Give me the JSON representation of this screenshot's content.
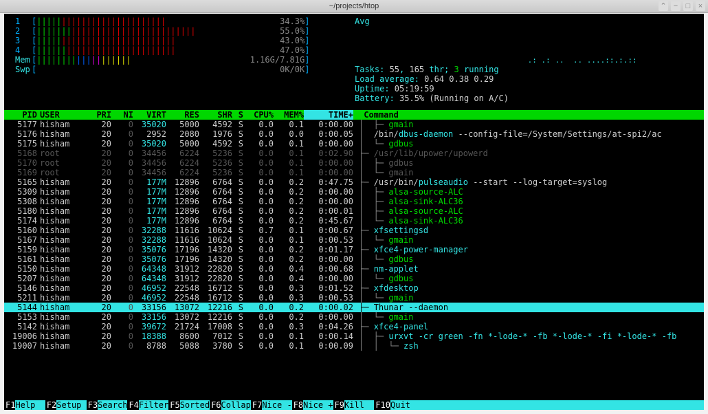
{
  "window": {
    "title": "~/projects/htop"
  },
  "cpu": [
    {
      "n": "1",
      "pct": "34.3%"
    },
    {
      "n": "2",
      "pct": "55.0%"
    },
    {
      "n": "3",
      "pct": "43.0%"
    },
    {
      "n": "4",
      "pct": "47.0%"
    }
  ],
  "mem": {
    "label": "Mem",
    "val": "1.16G/7.81G"
  },
  "swp": {
    "label": "Swp",
    "val": "0K/0K"
  },
  "avg_label": "Avg",
  "tasks": {
    "total": "55",
    "thr": "165",
    "running": "3"
  },
  "load": {
    "label": "Load average:",
    "v1": "0.64",
    "v2": "0.38",
    "v3": "0.29"
  },
  "uptime": {
    "label": "Uptime:",
    "v": "05:19:59"
  },
  "battery": {
    "label": "Battery:",
    "v": "35.5% (Running on A/C)"
  },
  "columns": [
    "  PID",
    "USER    ",
    "  PRI",
    "  NI",
    " VIRT",
    "  RES",
    "  SHR",
    " S",
    " CPU%",
    " MEM%",
    "   TIME+",
    " Command"
  ],
  "procs": [
    {
      "pid": "5177",
      "user": "hisham",
      "pri": "20",
      "ni": "0",
      "virt": "35020",
      "res": "5000",
      "shr": "4592",
      "s": "S",
      "cpu": "0.0",
      "mem": "0.1",
      "time": "0:00.00",
      "tree": "│  ├─ ",
      "cmd": "gmain",
      "style": "thr",
      "mvirt": true
    },
    {
      "pid": "5176",
      "user": "hisham",
      "pri": "20",
      "ni": "0",
      "virt": "2952",
      "res": "2080",
      "shr": "1976",
      "s": "S",
      "cpu": "0.0",
      "mem": "0.0",
      "time": "0:00.05",
      "tree": "│  ",
      "cmd": "/bin/dbus-daemon --config-file=/System/Settings/at-spi2/ac",
      "style": "path"
    },
    {
      "pid": "5175",
      "user": "hisham",
      "pri": "20",
      "ni": "0",
      "virt": "35020",
      "res": "5000",
      "shr": "4592",
      "s": "S",
      "cpu": "0.0",
      "mem": "0.1",
      "time": "0:00.00",
      "tree": "│  └─ ",
      "cmd": "gdbus",
      "style": "thr",
      "mvirt": true
    },
    {
      "pid": "5168",
      "user": "root",
      "pri": "20",
      "ni": "0",
      "virt": "34456",
      "res": "6224",
      "shr": "5236",
      "s": "S",
      "cpu": "0.0",
      "mem": "0.1",
      "time": "0:02.90",
      "tree": "├─ ",
      "cmd": "/usr/lib/upower/upowerd",
      "style": "dim"
    },
    {
      "pid": "5170",
      "user": "root",
      "pri": "20",
      "ni": "0",
      "virt": "34456",
      "res": "6224",
      "shr": "5236",
      "s": "S",
      "cpu": "0.0",
      "mem": "0.1",
      "time": "0:00.00",
      "tree": "│  ├─ ",
      "cmd": "gdbus",
      "style": "dim"
    },
    {
      "pid": "5169",
      "user": "root",
      "pri": "20",
      "ni": "0",
      "virt": "34456",
      "res": "6224",
      "shr": "5236",
      "s": "S",
      "cpu": "0.0",
      "mem": "0.1",
      "time": "0:00.00",
      "tree": "│  └─ ",
      "cmd": "gmain",
      "style": "dim"
    },
    {
      "pid": "5165",
      "user": "hisham",
      "pri": "20",
      "ni": "0",
      "virt": "177M",
      "res": "12896",
      "shr": "6764",
      "s": "S",
      "cpu": "0.0",
      "mem": "0.2",
      "time": "0:47.75",
      "tree": "├─ ",
      "cmd": "/usr/bin/pulseaudio --start --log-target=syslog",
      "style": "path",
      "mvirt": true
    },
    {
      "pid": "5309",
      "user": "hisham",
      "pri": "20",
      "ni": "0",
      "virt": "177M",
      "res": "12896",
      "shr": "6764",
      "s": "S",
      "cpu": "0.0",
      "mem": "0.2",
      "time": "0:00.00",
      "tree": "│  ├─ ",
      "cmd": "alsa-source-ALC",
      "style": "thr",
      "mvirt": true
    },
    {
      "pid": "5308",
      "user": "hisham",
      "pri": "20",
      "ni": "0",
      "virt": "177M",
      "res": "12896",
      "shr": "6764",
      "s": "S",
      "cpu": "0.0",
      "mem": "0.2",
      "time": "0:00.00",
      "tree": "│  ├─ ",
      "cmd": "alsa-sink-ALC36",
      "style": "thr",
      "mvirt": true
    },
    {
      "pid": "5180",
      "user": "hisham",
      "pri": "20",
      "ni": "0",
      "virt": "177M",
      "res": "12896",
      "shr": "6764",
      "s": "S",
      "cpu": "0.0",
      "mem": "0.2",
      "time": "0:00.01",
      "tree": "│  ├─ ",
      "cmd": "alsa-source-ALC",
      "style": "thr",
      "mvirt": true
    },
    {
      "pid": "5174",
      "user": "hisham",
      "pri": "20",
      "ni": "0",
      "virt": "177M",
      "res": "12896",
      "shr": "6764",
      "s": "S",
      "cpu": "0.0",
      "mem": "0.2",
      "time": "0:45.67",
      "tree": "│  └─ ",
      "cmd": "alsa-sink-ALC36",
      "style": "thr",
      "mvirt": true
    },
    {
      "pid": "5160",
      "user": "hisham",
      "pri": "20",
      "ni": "0",
      "virt": "32288",
      "res": "11616",
      "shr": "10624",
      "s": "S",
      "cpu": "0.7",
      "mem": "0.1",
      "time": "0:00.67",
      "tree": "├─ ",
      "cmd": "xfsettingsd",
      "style": "exe",
      "mvirt": true
    },
    {
      "pid": "5167",
      "user": "hisham",
      "pri": "20",
      "ni": "0",
      "virt": "32288",
      "res": "11616",
      "shr": "10624",
      "s": "S",
      "cpu": "0.0",
      "mem": "0.1",
      "time": "0:00.53",
      "tree": "│  └─ ",
      "cmd": "gmain",
      "style": "thr",
      "mvirt": true
    },
    {
      "pid": "5159",
      "user": "hisham",
      "pri": "20",
      "ni": "0",
      "virt": "35076",
      "res": "17196",
      "shr": "14320",
      "s": "S",
      "cpu": "0.0",
      "mem": "0.2",
      "time": "0:01.17",
      "tree": "├─ ",
      "cmd": "xfce4-power-manager",
      "style": "exe",
      "mvirt": true
    },
    {
      "pid": "5161",
      "user": "hisham",
      "pri": "20",
      "ni": "0",
      "virt": "35076",
      "res": "17196",
      "shr": "14320",
      "s": "S",
      "cpu": "0.0",
      "mem": "0.2",
      "time": "0:00.00",
      "tree": "│  └─ ",
      "cmd": "gdbus",
      "style": "thr",
      "mvirt": true
    },
    {
      "pid": "5150",
      "user": "hisham",
      "pri": "20",
      "ni": "0",
      "virt": "64348",
      "res": "31912",
      "shr": "22820",
      "s": "S",
      "cpu": "0.0",
      "mem": "0.4",
      "time": "0:00.68",
      "tree": "├─ ",
      "cmd": "nm-applet",
      "style": "exe",
      "mvirt": true
    },
    {
      "pid": "5207",
      "user": "hisham",
      "pri": "20",
      "ni": "0",
      "virt": "64348",
      "res": "31912",
      "shr": "22820",
      "s": "S",
      "cpu": "0.0",
      "mem": "0.4",
      "time": "0:00.00",
      "tree": "│  └─ ",
      "cmd": "gdbus",
      "style": "thr",
      "mvirt": true
    },
    {
      "pid": "5146",
      "user": "hisham",
      "pri": "20",
      "ni": "0",
      "virt": "46952",
      "res": "22548",
      "shr": "16712",
      "s": "S",
      "cpu": "0.0",
      "mem": "0.3",
      "time": "0:01.52",
      "tree": "├─ ",
      "cmd": "xfdesktop",
      "style": "exe",
      "mvirt": true
    },
    {
      "pid": "5211",
      "user": "hisham",
      "pri": "20",
      "ni": "0",
      "virt": "46952",
      "res": "22548",
      "shr": "16712",
      "s": "S",
      "cpu": "0.0",
      "mem": "0.3",
      "time": "0:00.53",
      "tree": "│  └─ ",
      "cmd": "gmain",
      "style": "thr",
      "mvirt": true
    },
    {
      "pid": "5144",
      "user": "hisham",
      "pri": "20",
      "ni": "0",
      "virt": "33156",
      "res": "13072",
      "shr": "12216",
      "s": "S",
      "cpu": "0.0",
      "mem": "0.2",
      "time": "0:00.02",
      "tree": "├─ ",
      "cmd": "Thunar --daemon",
      "style": "sel",
      "mvirt": false,
      "selected": true
    },
    {
      "pid": "5153",
      "user": "hisham",
      "pri": "20",
      "ni": "0",
      "virt": "33156",
      "res": "13072",
      "shr": "12216",
      "s": "S",
      "cpu": "0.0",
      "mem": "0.2",
      "time": "0:00.00",
      "tree": "│  └─ ",
      "cmd": "gmain",
      "style": "thr",
      "mvirt": true
    },
    {
      "pid": "5142",
      "user": "hisham",
      "pri": "20",
      "ni": "0",
      "virt": "39672",
      "res": "21724",
      "shr": "17008",
      "s": "S",
      "cpu": "0.0",
      "mem": "0.3",
      "time": "0:04.26",
      "tree": "├─ ",
      "cmd": "xfce4-panel",
      "style": "exe",
      "mvirt": true
    },
    {
      "pid": "19006",
      "user": "hisham",
      "pri": "20",
      "ni": "0",
      "virt": "18388",
      "res": "8600",
      "shr": "7012",
      "s": "S",
      "cpu": "0.0",
      "mem": "0.1",
      "time": "0:00.14",
      "tree": "│  ├─ ",
      "cmd": "urxvt -cr green -fn *-lode-* -fb *-lode-* -fi *-lode-* -fb",
      "style": "exe",
      "mvirt": true
    },
    {
      "pid": "19007",
      "user": "hisham",
      "pri": "20",
      "ni": "0",
      "virt": "8788",
      "res": "5088",
      "shr": "3780",
      "s": "S",
      "cpu": "0.0",
      "mem": "0.1",
      "time": "0:00.09",
      "tree": "│  │  └─ ",
      "cmd": "zsh",
      "style": "exe"
    }
  ],
  "fkeys": [
    {
      "k": "F1",
      "l": "Help  "
    },
    {
      "k": "F2",
      "l": "Setup "
    },
    {
      "k": "F3",
      "l": "Search"
    },
    {
      "k": "F4",
      "l": "Filter"
    },
    {
      "k": "F5",
      "l": "Sorted"
    },
    {
      "k": "F6",
      "l": "Collap"
    },
    {
      "k": "F7",
      "l": "Nice -"
    },
    {
      "k": "F8",
      "l": "Nice +"
    },
    {
      "k": "F9",
      "l": "Kill  "
    },
    {
      "k": "F10",
      "l": "Quit  "
    }
  ]
}
